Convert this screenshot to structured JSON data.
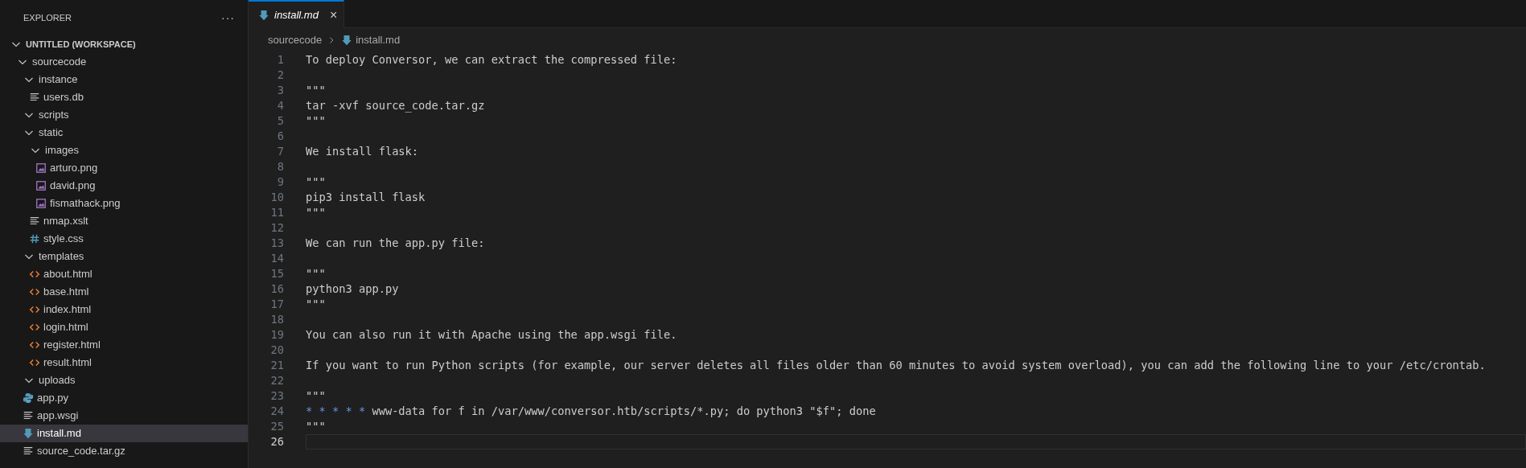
{
  "sidebar": {
    "title": "EXPLORER",
    "more_button": "···",
    "tree": [
      {
        "name": "UNTITLED (WORKSPACE)",
        "kind": "root",
        "expanded": true,
        "selected": false,
        "children": [
          {
            "name": "sourcecode",
            "kind": "folder",
            "expanded": true,
            "selected": false,
            "children": [
              {
                "name": "instance",
                "kind": "folder",
                "expanded": true,
                "selected": false,
                "children": [
                  {
                    "name": "users.db",
                    "kind": "text",
                    "selected": false
                  }
                ]
              },
              {
                "name": "scripts",
                "kind": "folder",
                "expanded": true,
                "selected": false
              },
              {
                "name": "static",
                "kind": "folder",
                "expanded": true,
                "selected": false,
                "children": [
                  {
                    "name": "images",
                    "kind": "folder",
                    "expanded": true,
                    "selected": false,
                    "children": [
                      {
                        "name": "arturo.png",
                        "kind": "image",
                        "selected": false
                      },
                      {
                        "name": "david.png",
                        "kind": "image",
                        "selected": false
                      },
                      {
                        "name": "fismathack.png",
                        "kind": "image",
                        "selected": false
                      }
                    ]
                  },
                  {
                    "name": "nmap.xslt",
                    "kind": "text",
                    "selected": false
                  },
                  {
                    "name": "style.css",
                    "kind": "css",
                    "selected": false
                  }
                ]
              },
              {
                "name": "templates",
                "kind": "folder",
                "expanded": true,
                "selected": false,
                "children": [
                  {
                    "name": "about.html",
                    "kind": "html",
                    "selected": false
                  },
                  {
                    "name": "base.html",
                    "kind": "html",
                    "selected": false
                  },
                  {
                    "name": "index.html",
                    "kind": "html",
                    "selected": false
                  },
                  {
                    "name": "login.html",
                    "kind": "html",
                    "selected": false
                  },
                  {
                    "name": "register.html",
                    "kind": "html",
                    "selected": false
                  },
                  {
                    "name": "result.html",
                    "kind": "html",
                    "selected": false
                  }
                ]
              },
              {
                "name": "uploads",
                "kind": "folder",
                "expanded": true,
                "selected": false
              },
              {
                "name": "app.py",
                "kind": "python",
                "selected": false
              },
              {
                "name": "app.wsgi",
                "kind": "text",
                "selected": false
              },
              {
                "name": "install.md",
                "kind": "markdown",
                "selected": true
              },
              {
                "name": "source_code.tar.gz",
                "kind": "text",
                "selected": false
              }
            ]
          }
        ]
      }
    ]
  },
  "tabs": [
    {
      "label": "install.md",
      "kind": "markdown",
      "selected": true,
      "close": "×"
    }
  ],
  "breadcrumb": [
    {
      "label": "sourcecode",
      "kind": "folder"
    },
    {
      "label": "install.md",
      "kind": "markdown"
    }
  ],
  "editor": {
    "lines": [
      {
        "number": "1",
        "text": "To deploy Conversor, we can extract the compressed file:",
        "current": false
      },
      {
        "number": "2",
        "current": false
      },
      {
        "number": "3",
        "text": "\"\"\"",
        "current": false
      },
      {
        "number": "4",
        "text": "tar -xvf source_code.tar.gz",
        "current": false
      },
      {
        "number": "5",
        "text": "\"\"\"",
        "current": false
      },
      {
        "number": "6",
        "current": false
      },
      {
        "number": "7",
        "text": "We install flask:",
        "current": false
      },
      {
        "number": "8",
        "current": false
      },
      {
        "number": "9",
        "text": "\"\"\"",
        "current": false
      },
      {
        "number": "10",
        "text": "pip3 install flask",
        "current": false
      },
      {
        "number": "11",
        "text": "\"\"\"",
        "current": false
      },
      {
        "number": "12",
        "current": false
      },
      {
        "number": "13",
        "text": "We can run the app.py file:",
        "current": false
      },
      {
        "number": "14",
        "current": false
      },
      {
        "number": "15",
        "text": "\"\"\"",
        "current": false
      },
      {
        "number": "16",
        "text": "python3 app.py",
        "current": false
      },
      {
        "number": "17",
        "text": "\"\"\"",
        "current": false
      },
      {
        "number": "18",
        "current": false
      },
      {
        "number": "19",
        "text": "You can also run it with Apache using the app.wsgi file.",
        "current": false
      },
      {
        "number": "20",
        "current": false
      },
      {
        "number": "21",
        "text": "If you want to run Python scripts (for example, our server deletes all files older than 60 minutes to avoid system overload), you can add the following line to your /etc/crontab.",
        "current": false
      },
      {
        "number": "22",
        "current": false
      },
      {
        "number": "23",
        "text": "\"\"\"",
        "current": false
      },
      {
        "number": "24",
        "list_marker": "* * * * *",
        "text": "www-data for f in /var/www/conversor.htb/scripts/*.py; do python3 \"$f\"; done",
        "current": false
      },
      {
        "number": "25",
        "text": "\"\"\"",
        "current": false
      },
      {
        "number": "26",
        "current": true
      }
    ]
  }
}
